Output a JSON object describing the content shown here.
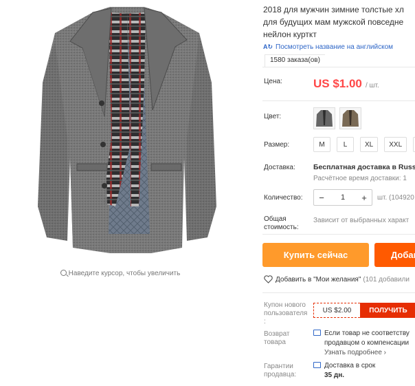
{
  "gallery": {
    "zoom_hint": "Наведите курсор, чтобы увеличить"
  },
  "product": {
    "title_lines": [
      "2018 для мужчин зимние толстые хл",
      "для будущих мам мужской повседне",
      "нейлон курткт"
    ],
    "translate_link": "Посмотреть название на английском",
    "orders": "1580 заказа(ов)"
  },
  "price": {
    "label": "Цена:",
    "amount": "US $1.00",
    "unit": "/ шт."
  },
  "color": {
    "label": "Цвет:",
    "options": [
      "gray-coat",
      "brown-coat"
    ]
  },
  "size": {
    "label": "Размер:",
    "options": [
      "M",
      "L",
      "XL",
      "XXL"
    ]
  },
  "shipping": {
    "label": "Доставка:",
    "text": "Бесплатная доставка в Russi",
    "eta": "Расчётное время доставки: 1"
  },
  "quantity": {
    "label": "Количество:",
    "value": "1",
    "minus": "−",
    "plus": "+",
    "available": "шт. (104920"
  },
  "total": {
    "label": "Общая стоимость:",
    "text": "Зависит от выбранных характ"
  },
  "actions": {
    "buy_now": "Купить сейчас",
    "add_to_cart": "Добав"
  },
  "wishlist": {
    "label": "Добавить в \"Мои желания\"",
    "count": "(101 добавили"
  },
  "coupon": {
    "label": "Купон нового пользователя :",
    "value": "US $2.00",
    "get": "ПОЛУЧИТЬ"
  },
  "returns": {
    "label": "Возврат товара",
    "line1": "Если товар не соответству",
    "line2": "продавцом о компенсации",
    "more": "Узнать подробнее ›"
  },
  "guarantee": {
    "label": "Гарантии продавца:",
    "text": "Доставка в срок",
    "days": "35 дн."
  },
  "colors": {
    "price": "#ff4747",
    "buy_now": "#ff9a2b",
    "add_to_cart": "#ff5a00",
    "coupon": "#e62e04",
    "link": "#2e66c7"
  }
}
